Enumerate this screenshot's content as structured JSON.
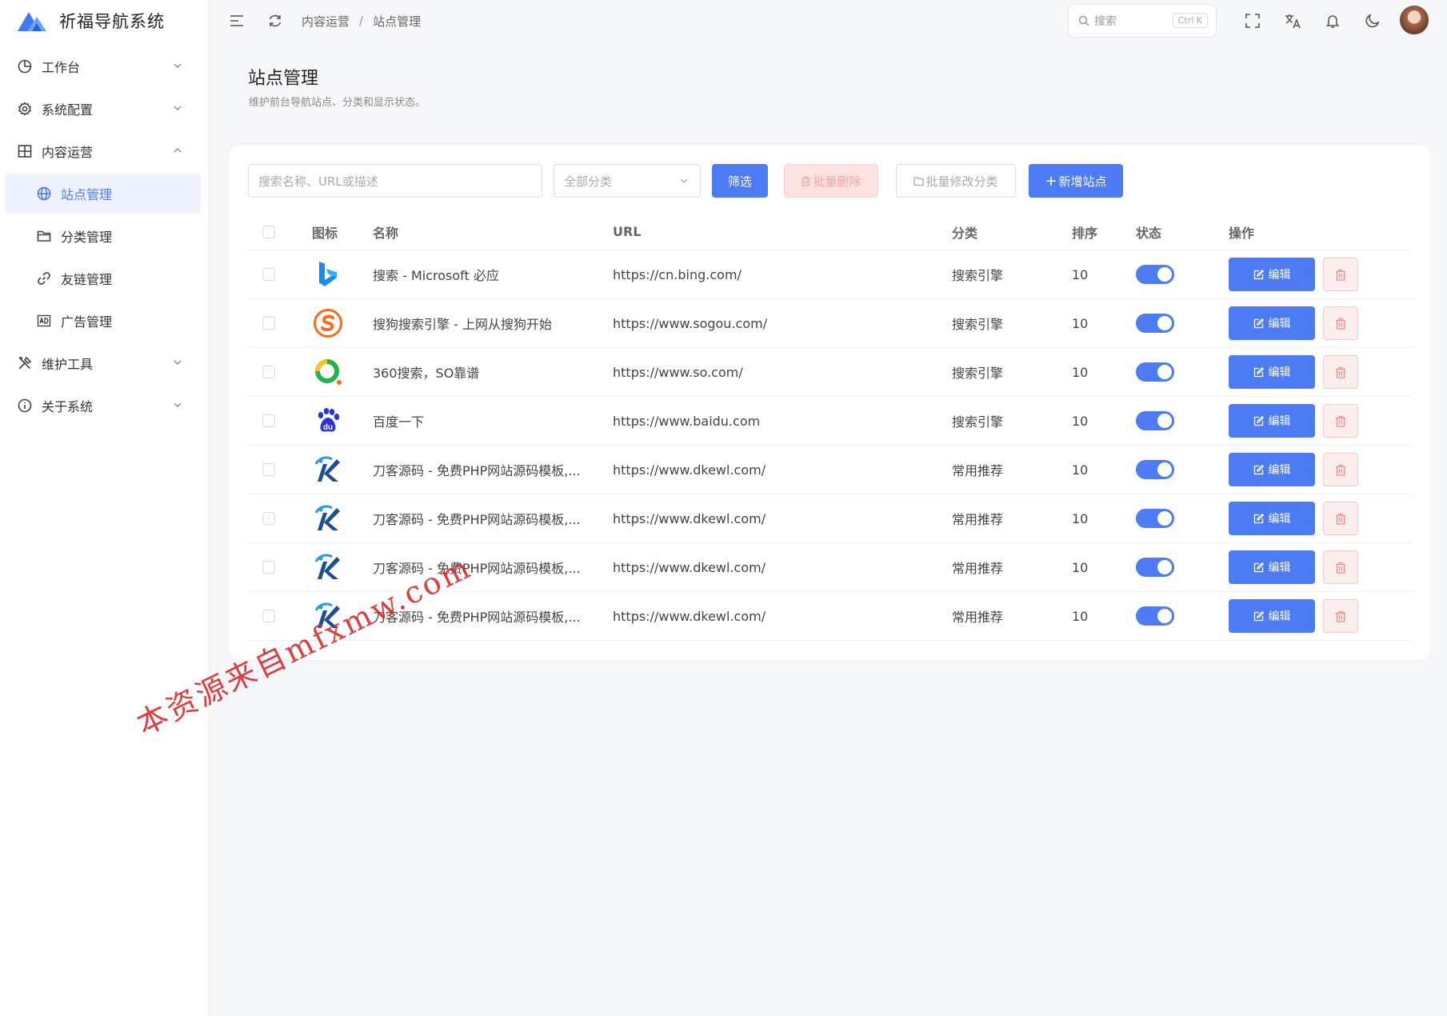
{
  "brand": {
    "name": "祈福导航系统"
  },
  "sidebar": {
    "items": [
      {
        "label": "工作台",
        "icon": "pie-chart-icon",
        "expanded": false
      },
      {
        "label": "系统配置",
        "icon": "gear-icon",
        "expanded": false
      },
      {
        "label": "内容运营",
        "icon": "grid-icon",
        "expanded": true
      },
      {
        "label": "站点管理",
        "icon": "globe-icon",
        "sub": true,
        "active": true
      },
      {
        "label": "分类管理",
        "icon": "folder-icon",
        "sub": true
      },
      {
        "label": "友链管理",
        "icon": "link-icon",
        "sub": true
      },
      {
        "label": "广告管理",
        "icon": "ad-icon",
        "sub": true
      },
      {
        "label": "维护工具",
        "icon": "tools-icon",
        "expanded": false
      },
      {
        "label": "关于系统",
        "icon": "info-icon",
        "expanded": false
      }
    ]
  },
  "header": {
    "breadcrumb": [
      "内容运营",
      "站点管理"
    ],
    "search_placeholder": "搜索",
    "search_shortcut": "Ctrl K"
  },
  "page": {
    "title": "站点管理",
    "subtitle": "维护前台导航站点、分类和显示状态。"
  },
  "toolbar": {
    "search_placeholder": "搜索名称、URL或描述",
    "category_select": "全部分类",
    "filter_label": "筛选",
    "batch_delete_label": "批量删除",
    "batch_modify_label": "批量修改分类",
    "add_label": "新增站点"
  },
  "table": {
    "headers": {
      "icon": "图标",
      "name": "名称",
      "url": "URL",
      "category": "分类",
      "sort": "排序",
      "status": "状态",
      "ops": "操作"
    },
    "edit_label": "编辑",
    "rows": [
      {
        "icon": "bing-logo-icon",
        "name": "搜索 - Microsoft 必应",
        "url": "https://cn.bing.com/",
        "category": "搜索引擎",
        "sort": "10",
        "enabled": true
      },
      {
        "icon": "sogou-logo-icon",
        "name": "搜狗搜索引擎 - 上网从搜狗开始",
        "url": "https://www.sogou.com/",
        "category": "搜索引擎",
        "sort": "10",
        "enabled": true
      },
      {
        "icon": "so360-logo-icon",
        "name": "360搜索，SO靠谱",
        "url": "https://www.so.com/",
        "category": "搜索引擎",
        "sort": "10",
        "enabled": true
      },
      {
        "icon": "baidu-logo-icon",
        "name": "百度一下",
        "url": "https://www.baidu.com",
        "category": "搜索引擎",
        "sort": "10",
        "enabled": true
      },
      {
        "icon": "dkewl-logo-icon",
        "name": "刀客源码 - 免费PHP网站源码模板,...",
        "url": "https://www.dkewl.com/",
        "category": "常用推荐",
        "sort": "10",
        "enabled": true
      },
      {
        "icon": "dkewl-logo-icon",
        "name": "刀客源码 - 免费PHP网站源码模板,...",
        "url": "https://www.dkewl.com/",
        "category": "常用推荐",
        "sort": "10",
        "enabled": true
      },
      {
        "icon": "dkewl-logo-icon",
        "name": "刀客源码 - 免费PHP网站源码模板,...",
        "url": "https://www.dkewl.com/",
        "category": "常用推荐",
        "sort": "10",
        "enabled": true
      },
      {
        "icon": "dkewl-logo-icon",
        "name": "刀客源码 - 免费PHP网站源码模板,...",
        "url": "https://www.dkewl.com/",
        "category": "常用推荐",
        "sort": "10",
        "enabled": true
      }
    ]
  },
  "watermark": "本资源来自mfxmw.com",
  "colors": {
    "accent": "#4d7bf3",
    "danger": "#f4a6a6",
    "watermark": "#d92b2b"
  }
}
